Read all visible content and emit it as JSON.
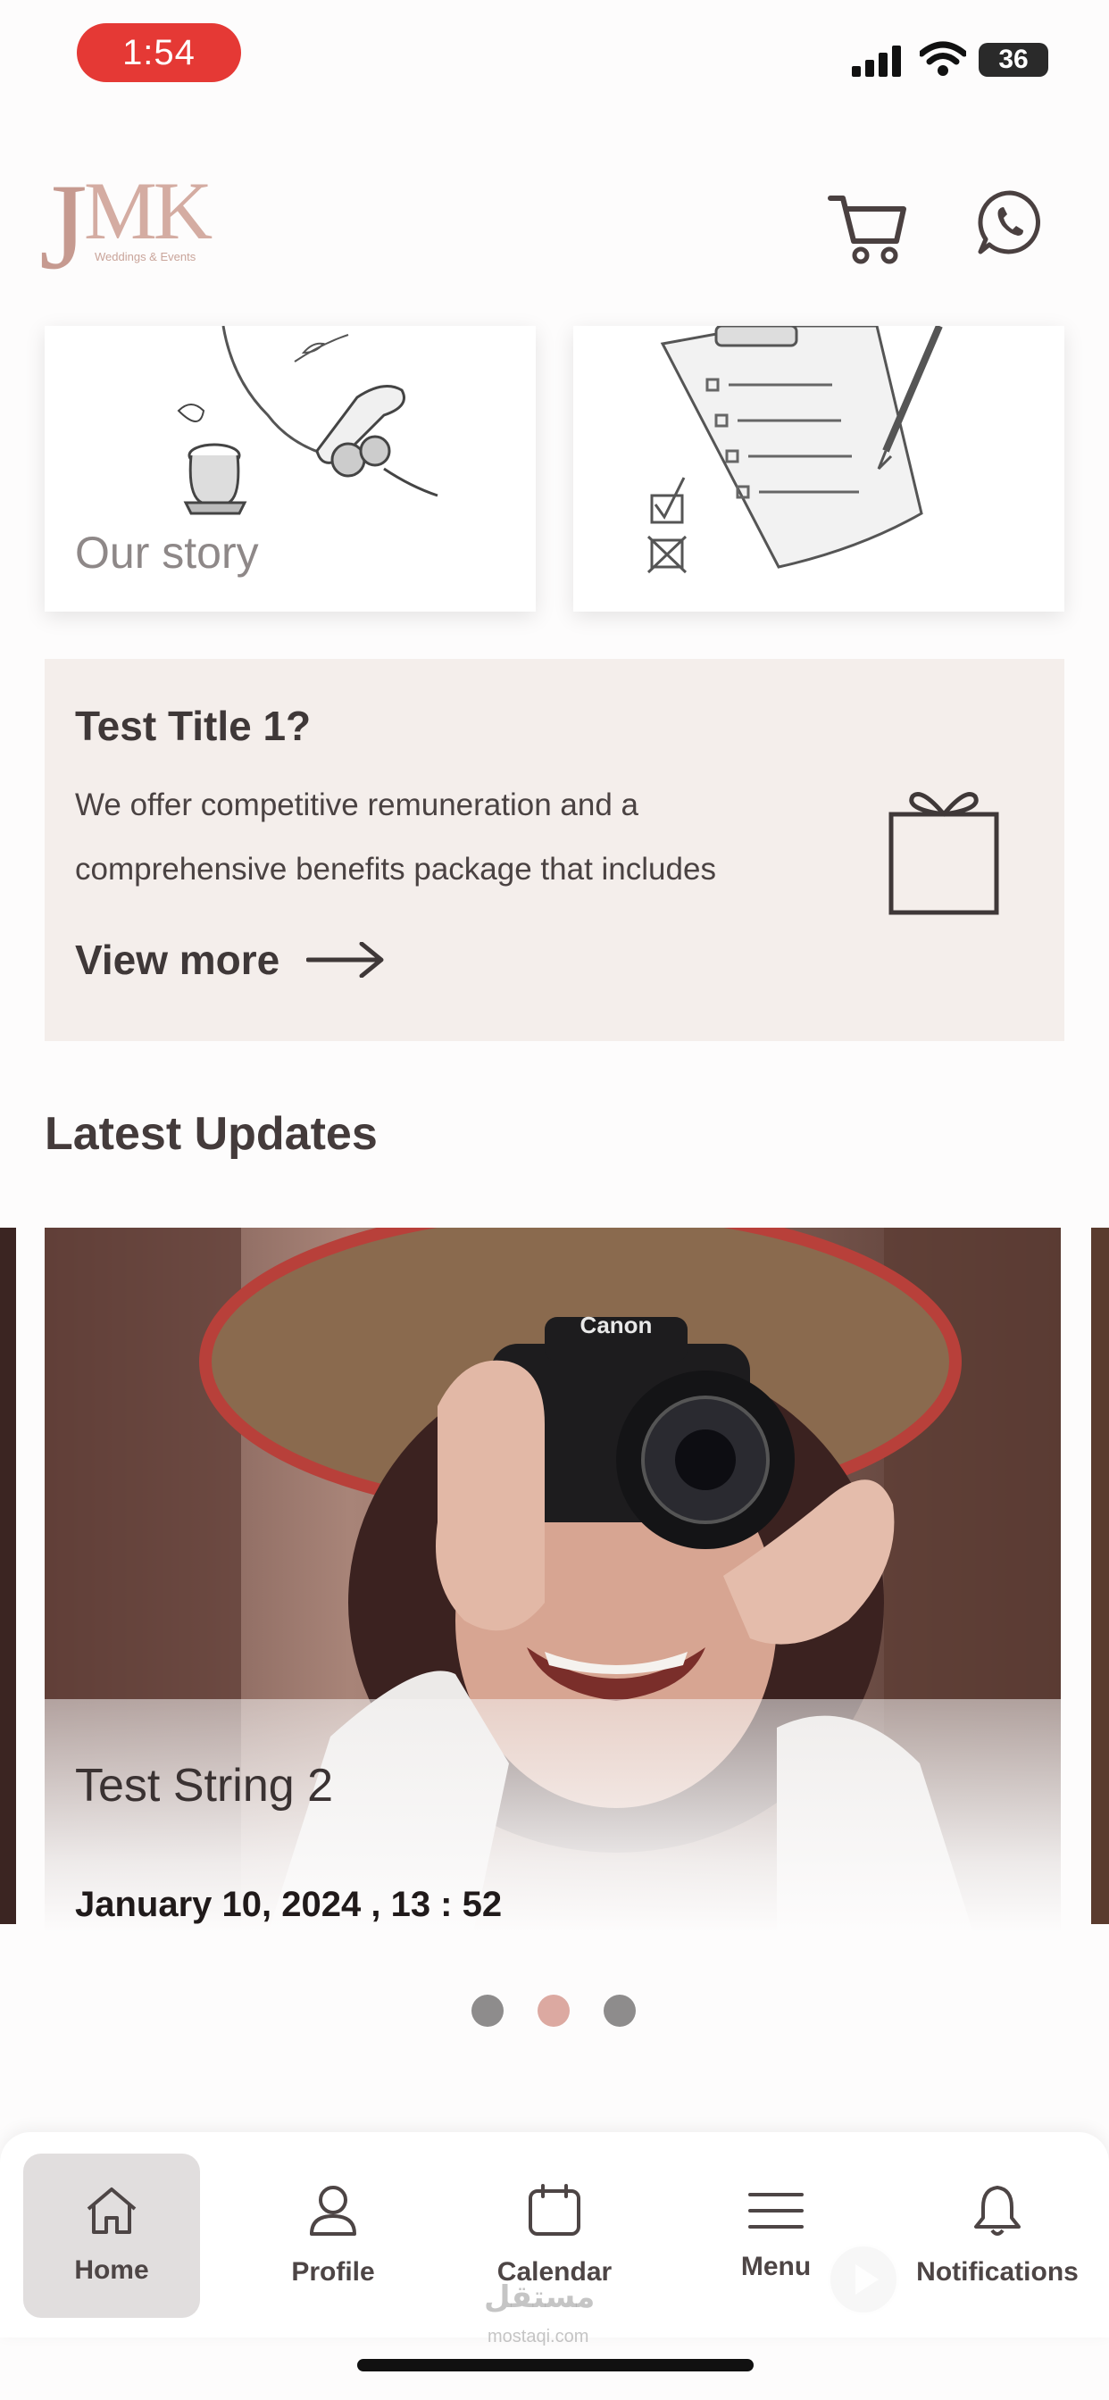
{
  "status_bar": {
    "time": "1:54",
    "battery": "36"
  },
  "brand": {
    "logo_j": "J",
    "logo_mk": "MK",
    "logo_subtitle": "Weddings & Events"
  },
  "header": {
    "cart_icon": "cart-icon",
    "whatsapp_icon": "whatsapp-icon"
  },
  "cards": [
    {
      "label": "Our story",
      "icon": "story-illustration"
    },
    {
      "label": "",
      "icon": "checklist-illustration"
    }
  ],
  "promo": {
    "title": "Test Title 1?",
    "text": "We offer competitive remuneration and a comprehensive benefits package that includes",
    "link_label": "View more",
    "icon": "gift-icon"
  },
  "latest_updates": {
    "title": "Latest Updates",
    "items": [
      {
        "title": "Test String 2",
        "date": "January 10, 2024 , 13 : 52"
      }
    ],
    "active_index": 1,
    "dot_count": 3
  },
  "bottom_nav": {
    "items": [
      {
        "label": "Home",
        "icon": "home-icon",
        "active": true
      },
      {
        "label": "Profile",
        "icon": "profile-icon",
        "active": false
      },
      {
        "label": "Calendar",
        "icon": "calendar-icon",
        "active": false
      },
      {
        "label": "Menu",
        "icon": "menu-icon",
        "active": false
      },
      {
        "label": "Notifications",
        "icon": "bell-icon",
        "active": false
      }
    ]
  },
  "watermark": {
    "text": "مستقل",
    "sub": "mostaqi.com"
  },
  "colors": {
    "accent": "#dca9a1",
    "banner": "#f4eeeb",
    "status_time": "#e53935"
  }
}
